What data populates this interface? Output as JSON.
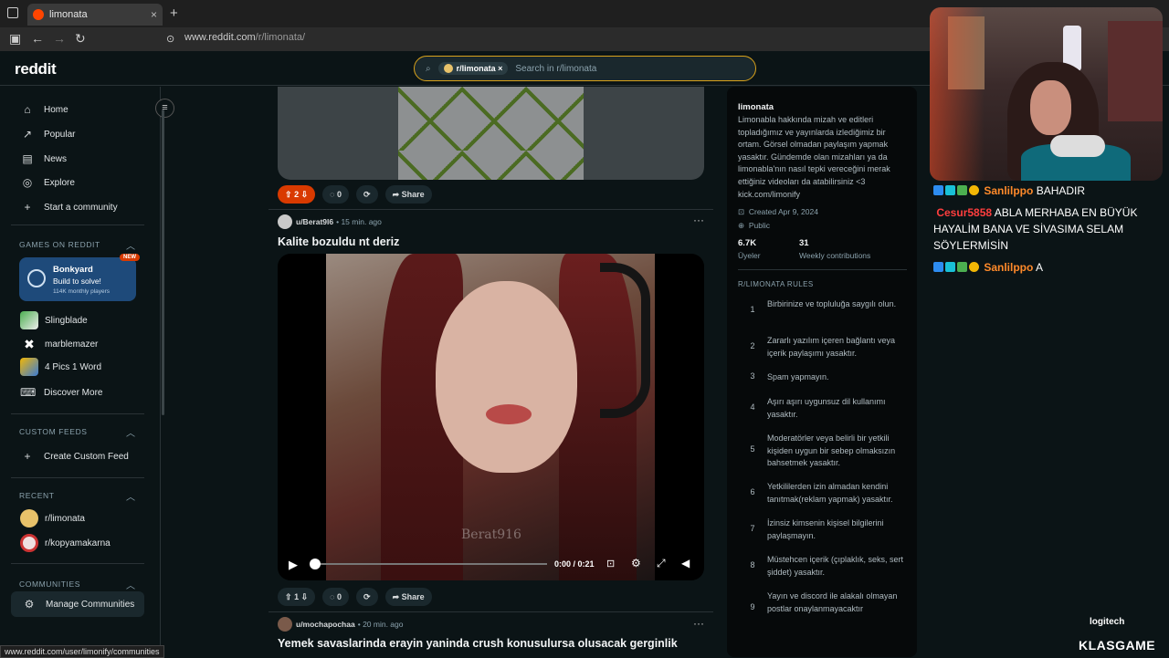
{
  "browser": {
    "tab_title": "limonata",
    "url_host": "www.reddit.com",
    "url_path": "/r/limonata/",
    "status_url": "www.reddit.com/user/limonify/communities"
  },
  "header": {
    "logo": "reddit",
    "search_chip": "r/limonata",
    "search_placeholder": "Search in r/limonata"
  },
  "sidebar": {
    "nav": [
      {
        "label": "Home",
        "icon": "home-icon"
      },
      {
        "label": "Popular",
        "icon": "popular-icon"
      },
      {
        "label": "News",
        "icon": "news-icon"
      },
      {
        "label": "Explore",
        "icon": "explore-icon"
      },
      {
        "label": "Start a community",
        "icon": "plus-icon"
      }
    ],
    "games_heading": "GAMES ON REDDIT",
    "featured_game": {
      "name": "Bonkyard",
      "tagline": "Build to solve!",
      "players": "114K monthly players",
      "badge": "NEW"
    },
    "games": [
      "Slingblade",
      "marblemazer",
      "4 Pics 1 Word",
      "Discover More"
    ],
    "custom_feeds_heading": "CUSTOM FEEDS",
    "create_feed": "Create Custom Feed",
    "recent_heading": "RECENT",
    "recent": [
      "r/limonata",
      "r/kopyamakarna"
    ],
    "communities_heading": "COMMUNITIES",
    "manage": "Manage Communities"
  },
  "feed": {
    "post1": {
      "votes": "2",
      "comments": "0",
      "share": "Share"
    },
    "post2": {
      "author": "u/Berat9l6",
      "age": "15 min. ago",
      "title": "Kalite bozuldu nt deriz",
      "watermark": "Berat916",
      "time": "0:00 / 0:21",
      "votes": "1",
      "comments": "0",
      "share": "Share"
    },
    "post3": {
      "author": "u/mochapochaa",
      "age": "20 min. ago",
      "title": "Yemek savaslarinda erayin yaninda crush konusulursa olusacak gerginlik"
    }
  },
  "community": {
    "name": "limonata",
    "description": "Limonabla hakkında mizah ve editleri topladığımız ve yayınlarda izlediğimiz bir ortam. Görsel olmadan paylaşım yapmak yasaktır. Gündemde olan mizahları ya da limonabla'nın nasıl tepki vereceğini merak ettiğiniz videoları da atabilirsiniz <3 kick.com/limonify",
    "created": "Created Apr 9, 2024",
    "visibility": "Public",
    "members": "6.7K",
    "members_label": "Üyeler",
    "contributions": "31",
    "contributions_label": "Weekly contributions",
    "rules_heading": "R/LIMONATA RULES",
    "rules": [
      "Birbirinize ve topluluğa saygılı olun.",
      "Zararlı yazılım içeren bağlantı veya içerik paylaşımı yasaktır.",
      "Spam yapmayın.",
      "Aşırı aşırı uygunsuz dil kullanımı yasaktır.",
      "Moderatörler veya belirli bir yetkili kişiden uygun bir sebep olmaksızın bahsetmek yasaktır.",
      "Yetkililerden izin almadan kendini tanıtmak(reklam yapmak) yasaktır.",
      "İzinsiz kimsenin kişisel bilgilerini paylaşmayın.",
      "Müstehcen içerik (çıplaklık, seks, sert şiddet) yasaktır.",
      "Yayın ve discord ile alakalı olmayan postlar onaylanmayacaktır"
    ]
  },
  "stream": {
    "chat": [
      {
        "user": "Sanlilppo",
        "msg": "BAHADIR"
      },
      {
        "user": "Cesur5858",
        "msg": "ABLA MERHABA EN BÜYÜK HAYALİM BANA VE SİVASIMA SELAM SÖYLERMİSİN"
      },
      {
        "user": "Sanlilppo",
        "msg": "A"
      }
    ],
    "sponsor1": "logitech",
    "sponsor2": "KLASGAME"
  },
  "colors": {
    "accent": "#d9a21b",
    "upvote": "#d93a00",
    "chat_user": "#ff8a2a"
  }
}
